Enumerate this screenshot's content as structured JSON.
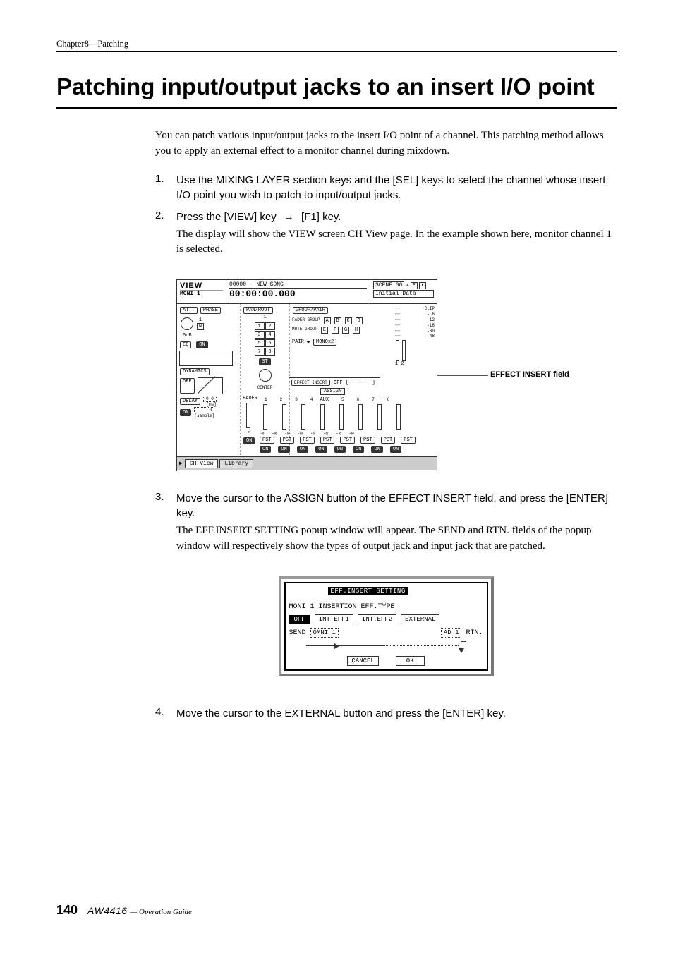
{
  "chapter_header": "Chapter8—Patching",
  "main_title": "Patching input/output jacks to an insert I/O point",
  "intro": "You can patch various input/output jacks to the insert I/O point of a channel. This patching method allows you to apply an external effect to a monitor channel during mixdown.",
  "steps": [
    {
      "num": "1.",
      "instruction": "Use the MIXING LAYER section keys and the [SEL] keys to select the channel whose insert I/O point you wish to patch to input/output jacks."
    },
    {
      "num": "2.",
      "instruction_pre": "Press the [VIEW] key ",
      "instruction_post": " [F1] key.",
      "description": "The display will show the VIEW screen CH View page. In the example shown here, monitor channel 1 is selected."
    },
    {
      "num": "3.",
      "instruction": "Move the cursor to the ASSIGN button of the EFFECT INSERT field, and press the [ENTER] key.",
      "description": "The EFF.INSERT SETTING popup window will appear. The SEND and RTN. fields of the popup window will respectively show the types of output jack and input jack that are patched."
    },
    {
      "num": "4.",
      "instruction": "Move the cursor to the EXTERNAL button and press the [ENTER] key."
    }
  ],
  "callout": "EFFECT INSERT field",
  "figure1": {
    "view": "VIEW",
    "moni": "MONI 1",
    "song": "00000 - NEW SONG",
    "time": "00:00:00.000",
    "scene_label": "SCENE 00",
    "scene_initial": "Initial Data",
    "e_icon": "E",
    "sections": {
      "att": "ATT.",
      "att_val": "0dB",
      "phase": "PHASE",
      "phase_n": "N",
      "eq": "EQ",
      "eq_on": "ON",
      "dynamics": "DYNAMICS",
      "dynamics_off": "OFF",
      "delay": "DELAY",
      "delay_val": "0.0",
      "delay_ms": "[ms]",
      "delay_on": "ON",
      "delay_sample": "[sample]",
      "pan_rout": "PAN/ROUT",
      "st": "ST",
      "center": "CENTER",
      "group_pair": "GROUP/PAIR",
      "fader_group": "FADER GROUP",
      "mute_group": "MUTE GROUP",
      "pair": "PAIR",
      "mono": "MONOx2",
      "effect_insert": "EFFECT INSERT",
      "insert_off": "OFF",
      "assign": "ASSIGN",
      "fader": "FADER",
      "aux": "AUX",
      "pst": "PST",
      "on": "ON",
      "inf": "-∞"
    },
    "meter_labels": [
      "CLIP",
      "- 6",
      "-12",
      "-18",
      "-30",
      "-48"
    ],
    "meter_nums": "1  2",
    "grid_nums": [
      "1",
      "2",
      "3",
      "4",
      "5",
      "6",
      "7",
      "8"
    ],
    "fader_groups": [
      "A",
      "B",
      "C",
      "D"
    ],
    "mute_groups": [
      "E",
      "F",
      "G",
      "H"
    ],
    "fader_nums": [
      "1",
      "2",
      "3",
      "4",
      "5",
      "6",
      "7",
      "8"
    ],
    "tabs": [
      "CH View",
      "Library"
    ]
  },
  "figure2": {
    "title": "EFF.INSERT SETTING",
    "channel_label": "MONI  1  INSERTION EFF.TYPE",
    "off": "OFF",
    "int_eff1": "INT.EFF1",
    "int_eff2": "INT.EFF2",
    "external": "EXTERNAL",
    "send_label": "SEND",
    "send_val": "OMNI    1",
    "rtn_val": "AD      1",
    "rtn_label": "RTN.",
    "cancel": "CANCEL",
    "ok": "OK"
  },
  "footer": {
    "page": "140",
    "product": "AW4416",
    "guide": "— Operation Guide"
  }
}
